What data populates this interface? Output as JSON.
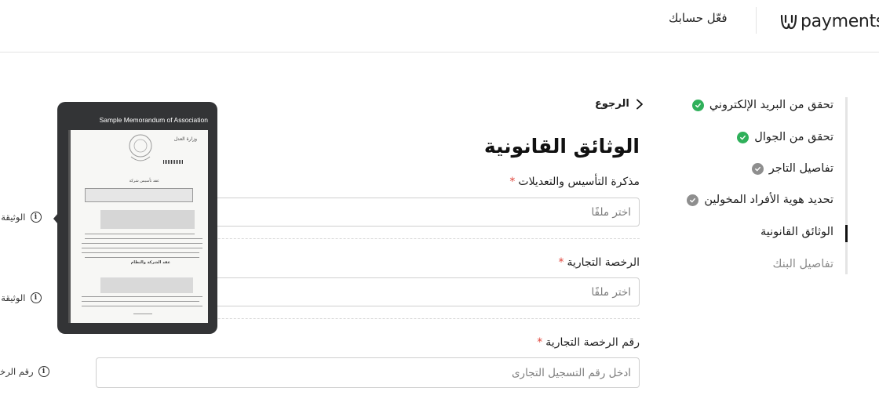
{
  "header": {
    "logo_text": "payments",
    "activate_label": "فعّل حسابك"
  },
  "stepper": {
    "items": [
      {
        "label": "تحقق من البريد الإلكتروني",
        "status": "done"
      },
      {
        "label": "تحقق من الجوال",
        "status": "done"
      },
      {
        "label": "تفاصيل التاجر",
        "status": "pending"
      },
      {
        "label": "تحديد هوية الأفراد المخولين",
        "status": "pending"
      },
      {
        "label": "الوثائق القانونية",
        "status": "active"
      },
      {
        "label": "تفاصيل البنك",
        "status": "upcoming"
      }
    ]
  },
  "main": {
    "back_label": "الرجوع",
    "title": "الوثائق القانونية",
    "fields": [
      {
        "label": "مذكرة التأسيس والتعديلات",
        "required": "*",
        "placeholder": "اختر ملفًا"
      },
      {
        "label": "الرخصة التجارية",
        "required": "*",
        "placeholder": "اختر ملفًا"
      },
      {
        "label": "رقم الرخصة التجارية",
        "required": "*",
        "placeholder": "ادخل رقم التسجيل التجارى"
      }
    ]
  },
  "left_hints": [
    {
      "label": "الوثيقة ال"
    },
    {
      "label": "الوثيقة ال"
    },
    {
      "label": "رقم الرخص"
    }
  ],
  "tooltip": {
    "title": "Sample Memorandum of Association",
    "doc_heading": "وزارة العدل",
    "doc_subtitle": "عقد تأسيس شركة",
    "doc_section": "عقد الشركة والنظام"
  },
  "colors": {
    "done": "#2fb05a",
    "pending": "#8e8e8e",
    "required": "#e0463c",
    "tooltip_bg": "#333436"
  }
}
